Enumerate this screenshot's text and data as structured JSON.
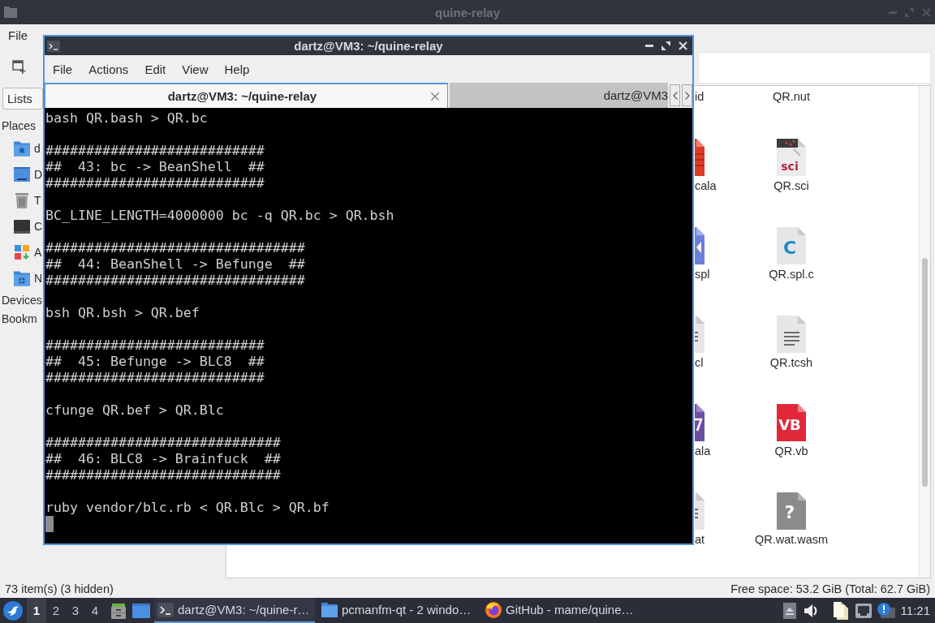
{
  "file_manager": {
    "title": "quine-relay",
    "menu": [
      "File"
    ],
    "sidebar": {
      "mode_button": "Lists",
      "sections": [
        {
          "title": "Places",
          "items": [
            {
              "label": "d",
              "kind": "home"
            },
            {
              "label": "D",
              "kind": "desktop"
            },
            {
              "label": "T",
              "kind": "trash"
            },
            {
              "label": "C",
              "kind": "computer"
            },
            {
              "label": "A",
              "kind": "applications"
            },
            {
              "label": "N",
              "kind": "network"
            }
          ]
        },
        {
          "title": "Devices"
        },
        {
          "title": "Bookm"
        }
      ]
    },
    "files": {
      "rows": [
        [
          {
            "label": "id"
          },
          {
            "label": "QR.nut"
          }
        ],
        [
          {
            "label": "cala",
            "kind": "scala"
          },
          {
            "label": "QR.sci",
            "kind": "sci",
            "icon_text": "sci"
          }
        ],
        [
          {
            "label": "spl",
            "kind": "spl"
          },
          {
            "label": "QR.spl.c",
            "kind": "c",
            "icon_text": "C"
          }
        ],
        [
          {
            "label": "cl",
            "kind": "text"
          },
          {
            "label": "QR.tcsh",
            "kind": "text"
          }
        ],
        [
          {
            "label": "ala",
            "kind": "vala"
          },
          {
            "label": "QR.vb",
            "kind": "vb",
            "icon_text": "VB"
          }
        ],
        [
          {
            "label": "at",
            "kind": "text"
          },
          {
            "label": "QR.wat.wasm",
            "kind": "unknown",
            "icon_text": "?"
          }
        ]
      ]
    },
    "status_bar": {
      "left": "73 item(s) (3 hidden)",
      "right": "Free space: 53.2 GiB (Total: 62.7 GiB)"
    }
  },
  "terminal": {
    "title": "dartz@VM3: ~/quine-relay",
    "menu": [
      "File",
      "Actions",
      "Edit",
      "View",
      "Help"
    ],
    "tabs": [
      {
        "label": "dartz@VM3: ~/quine-relay",
        "selected": true
      },
      {
        "label": "dartz@VM3",
        "selected": false
      }
    ],
    "output": [
      [
        "bash QR.bash > QR.bc"
      ],
      [
        "###########################",
        "##  43: bc -> BeanShell  ##",
        "###########################"
      ],
      [
        "BC_LINE_LENGTH=4000000 bc -q QR.bc > QR.bsh"
      ],
      [
        "################################",
        "##  44: BeanShell -> Befunge  ##",
        "################################"
      ],
      [
        "bsh QR.bsh > QR.bef"
      ],
      [
        "###########################",
        "##  45: Befunge -> BLC8  ##",
        "###########################"
      ],
      [
        "cfunge QR.bef > QR.Blc"
      ],
      [
        "#############################",
        "##  46: BLC8 -> Brainfuck  ##",
        "#############################"
      ],
      [
        "ruby vendor/blc.rb < QR.Blc > QR.bf"
      ]
    ]
  },
  "taskbar": {
    "workspaces": [
      {
        "label": "1",
        "selected": true
      },
      {
        "label": "2",
        "selected": false
      },
      {
        "label": "3",
        "selected": false
      },
      {
        "label": "4",
        "selected": false
      }
    ],
    "tasks": [
      {
        "label": "dartz@VM3: ~/quine-r…",
        "kind": "terminal",
        "selected": true
      },
      {
        "label": "pcmanfm-qt - 2 windo…",
        "kind": "folder",
        "selected": false
      },
      {
        "label": "GitHub - mame/quine…",
        "kind": "browser",
        "selected": false
      }
    ],
    "clock": "11:21"
  }
}
